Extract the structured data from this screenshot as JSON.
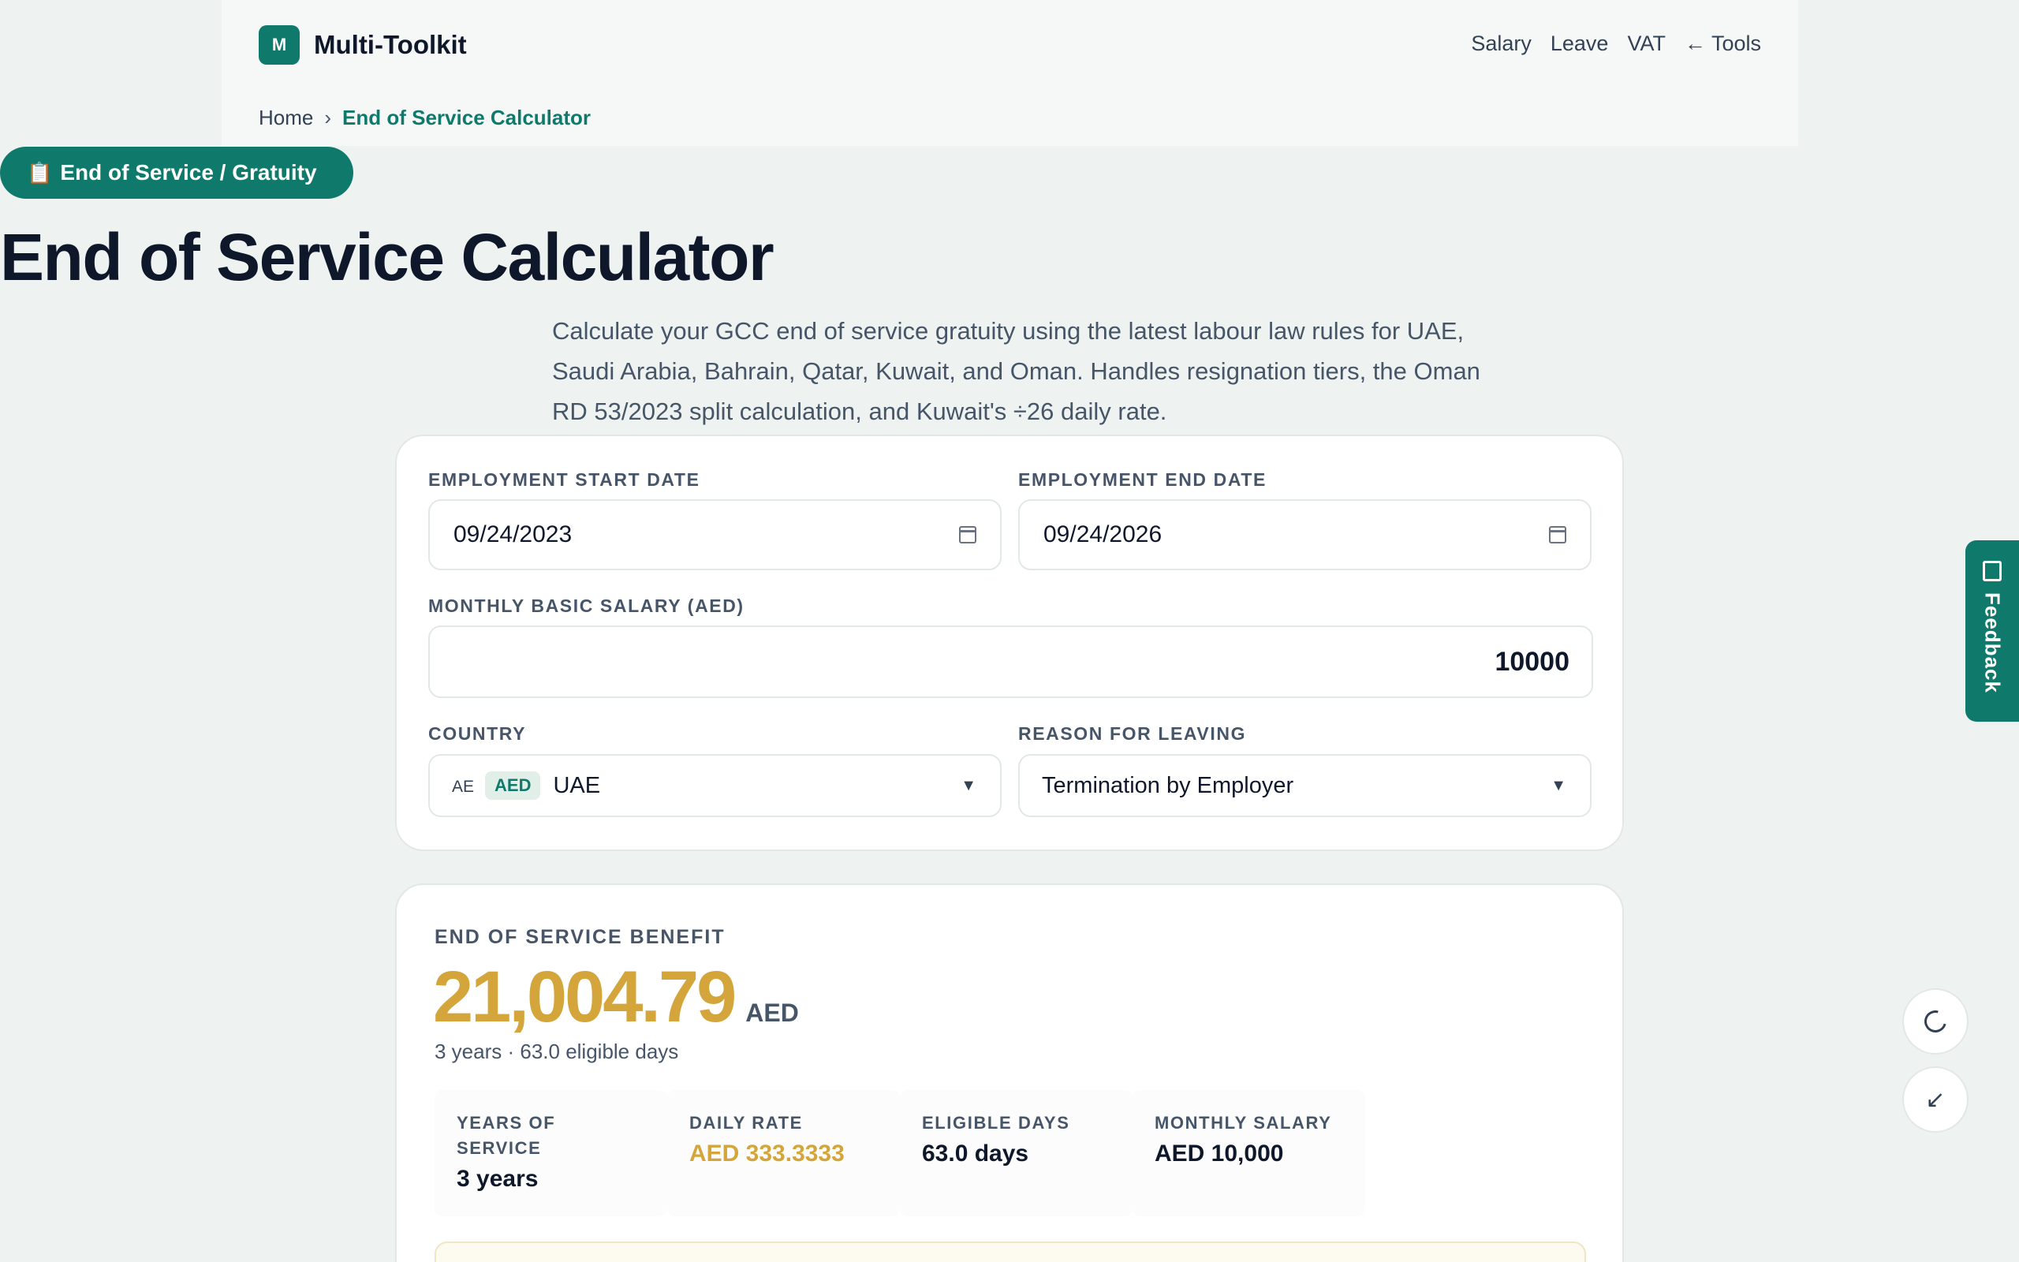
{
  "header": {
    "logo_letter": "M",
    "brand": "Multi-Toolkit",
    "nav": [
      "Salary",
      "Leave",
      "VAT",
      "← Tools"
    ]
  },
  "breadcrumb": {
    "home": "Home",
    "separator": "›",
    "current": "End of Service Calculator"
  },
  "hero": {
    "badge_icon": "📋",
    "badge_label": "End of Service / Gratuity",
    "title": "End of Service Calculator",
    "intro": "Calculate your GCC end of service gratuity using the latest labour law rules for UAE, Saudi Arabia, Bahrain, Qatar, Kuwait, and Oman. Handles resignation tiers, the Oman RD 53/2023 split calculation, and Kuwait's ÷26 daily rate."
  },
  "form": {
    "start_date_label": "EMPLOYMENT START DATE",
    "start_date_value": "09/24/2023",
    "end_date_label": "EMPLOYMENT END DATE",
    "end_date_value": "09/24/2026",
    "salary_label": "MONTHLY BASIC SALARY (AED)",
    "salary_value": "10000",
    "country_label": "COUNTRY",
    "country_code": "AE",
    "country_currency": "AED",
    "country_value": "UAE",
    "reason_label": "REASON FOR LEAVING",
    "reason_value": "Termination by Employer",
    "caret": "▼"
  },
  "result": {
    "label": "END OF SERVICE BENEFIT",
    "amount": "21,004.79",
    "currency": "AED",
    "summary": "3 years · 63.0 eligible days",
    "stats": [
      {
        "label": "YEARS OF SERVICE",
        "value": "3 years"
      },
      {
        "label": "DAILY RATE",
        "value": "AED 333.3333"
      },
      {
        "label": "ELIGIBLE DAYS",
        "value": "63.0 days"
      },
      {
        "label": "MONTHLY SALARY",
        "value": "AED 10,000"
      }
    ]
  },
  "floating": {
    "feedback": "Feedback"
  },
  "colors": {
    "brand": "#0f7a6c",
    "gold": "#d4a53a",
    "background": "#eef2f0"
  },
  "icons": {
    "calendar": "calendar-icon",
    "moon": "moon-icon",
    "collapse": "collapse-icon",
    "feedback": "feedback-icon"
  }
}
